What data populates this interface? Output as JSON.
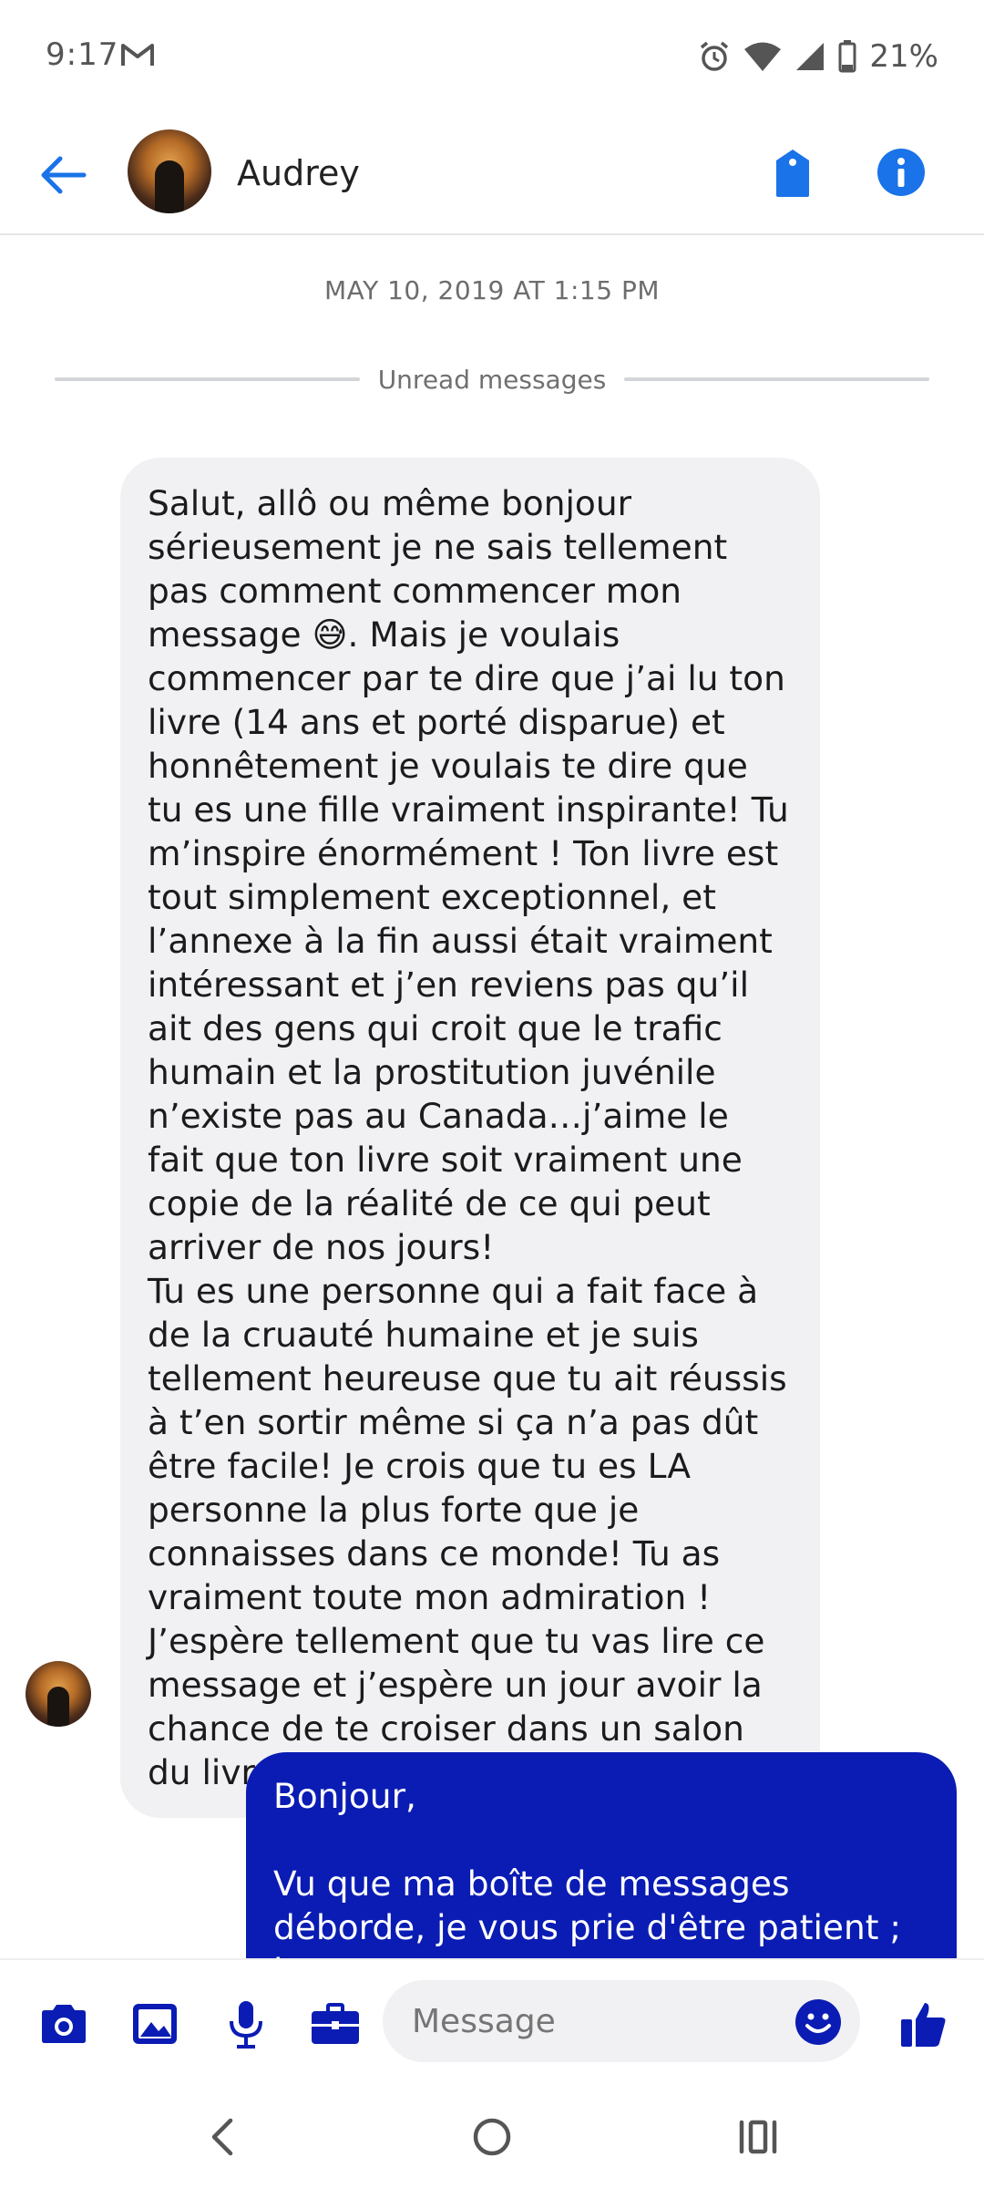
{
  "status_bar": {
    "time": "9:17",
    "battery": "21%"
  },
  "header": {
    "contact_name": "Audrey"
  },
  "conversation": {
    "timestamp": "MAY 10, 2019 AT 1:15 PM",
    "unread_label": "Unread messages",
    "incoming_message": "Salut, allô ou même bonjour sérieusement je ne sais tellement pas comment commencer mon message 😅. Mais je voulais commencer par te dire que j’ai lu ton livre (14 ans et porté disparue) et honnêtement je voulais te dire que tu es une fille vraiment inspirante! Tu m’inspire énormément ! Ton livre est tout simplement exceptionnel, et l’annexe à la fin aussi était vraiment intéressant et j’en reviens pas qu’il ait des gens qui croit que le trafic humain et la prostitution juvénile n’existe pas au Canada…j’aime le fait que ton livre soit vraiment une copie de la réalité de ce qui peut arriver de nos jours!\nTu es une personne qui a fait face à de la cruauté humaine et je suis tellement heureuse que tu ait réussis à t’en sortir même si ça n’a pas dût être facile! Je crois que tu es LA personne la plus forte que je connaisses dans ce monde! Tu as vraiment toute mon admiration ! J’espère tellement que tu vas lire ce message et j’espère un jour avoir la chance de te croiser dans un salon du livre😊💛",
    "outgoing_message": "Bonjour,\n\nVu que ma boîte de messages déborde, je vous prie d'être patient ; je vous"
  },
  "composer": {
    "placeholder": "Message"
  },
  "colors": {
    "accent": "#1a73e8",
    "messenger_blue": "#0a1cb3",
    "bubble_gray": "#f1f1f4"
  },
  "icons": [
    "gmail-icon",
    "alarm-icon",
    "wifi-icon",
    "signal-icon",
    "battery-icon",
    "back-arrow-icon",
    "tag-icon",
    "info-icon",
    "camera-icon",
    "image-icon",
    "microphone-icon",
    "briefcase-icon",
    "emoji-icon",
    "thumbs-up-icon",
    "nav-back-icon",
    "nav-home-icon",
    "nav-recents-icon"
  ]
}
